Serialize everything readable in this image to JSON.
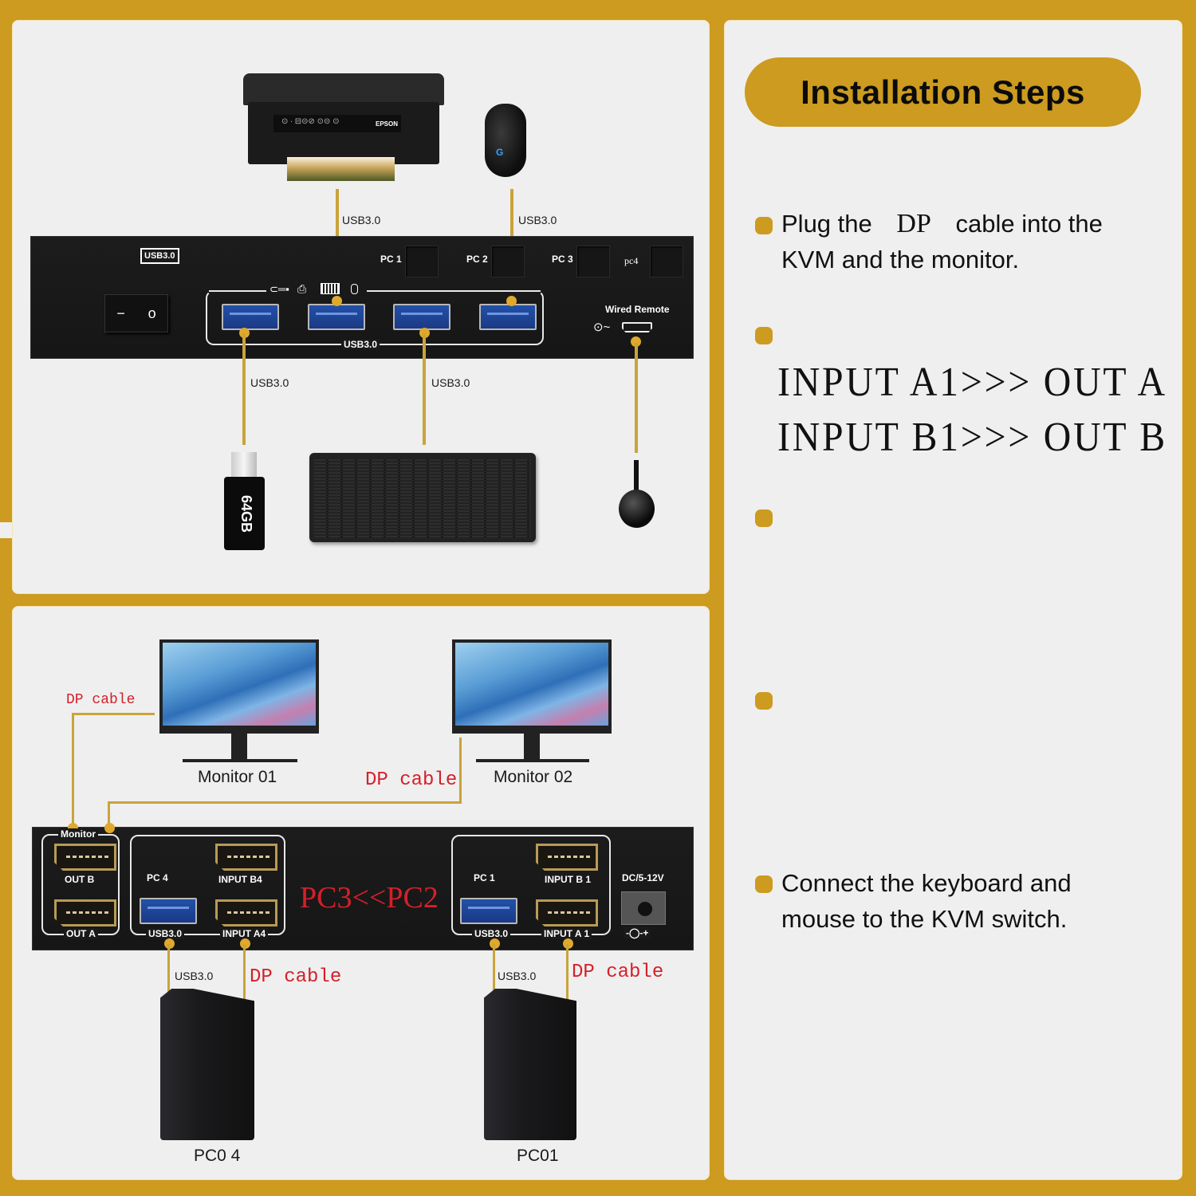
{
  "colors": {
    "frame": "#cc9b1f",
    "panel": "#efefef",
    "cable": "#c9a43a",
    "red_label": "#d4202a"
  },
  "top_diagram": {
    "printer": {
      "brand": "EPSON",
      "cable_label": "USB3.0"
    },
    "mouse": {
      "cable_label": "USB3.0"
    },
    "kvm_front": {
      "badge": "USB3.0",
      "power_switch": {
        "on": "−",
        "off": "o"
      },
      "pc_buttons": [
        "PC 1",
        "PC 2",
        "PC 3",
        "pc4"
      ],
      "usb_group_label": "USB3.0",
      "port_icons": [
        "usb-drive-icon",
        "printer-icon",
        "keyboard-icon",
        "mouse-icon"
      ],
      "wired_remote_label": "Wired Remote"
    },
    "usb_drive": {
      "capacity": "64GB",
      "cable_label": "USB3.0"
    },
    "keyboard": {
      "cable_label": "USB3.0"
    }
  },
  "bottom_diagram": {
    "monitor1": {
      "label": "Monitor 01",
      "cable_label": "DP cable"
    },
    "monitor2": {
      "label": "Monitor 02",
      "cable_label": "DP cable"
    },
    "kvm_back": {
      "monitor_group": "Monitor",
      "out_b": "OUT B",
      "out_a": "OUT A",
      "pc4_label": "PC 4",
      "input_b4": "INPUT B4",
      "input_a4": "INPUT A4",
      "usb_left": "USB3.0",
      "center_text": "PC3<<PC2",
      "pc1_label": "PC 1",
      "input_b1": "INPUT B 1",
      "input_a1": "INPUT A 1",
      "usb_right": "USB3.0",
      "power_label": "DC/5-12V",
      "polarity": "-◯-+"
    },
    "pc04": {
      "label": "PC0 4",
      "usb_label": "USB3.0",
      "dp_label": "DP cable"
    },
    "pc01": {
      "label": "PC01",
      "usb_label": "USB3.0",
      "dp_label": "DP cable"
    }
  },
  "steps": {
    "title": "Installation Steps",
    "step1": {
      "pre": "Plug the",
      "dp": "DP",
      "post": "cable into the",
      "line2": "KVM and the monitor."
    },
    "step2": {
      "line1": "INPUT A1>>> OUT A",
      "line2": "INPUT B1>>> OUT B"
    },
    "step5": {
      "line1": "Connect the keyboard and",
      "line2": "mouse to the KVM switch."
    }
  }
}
